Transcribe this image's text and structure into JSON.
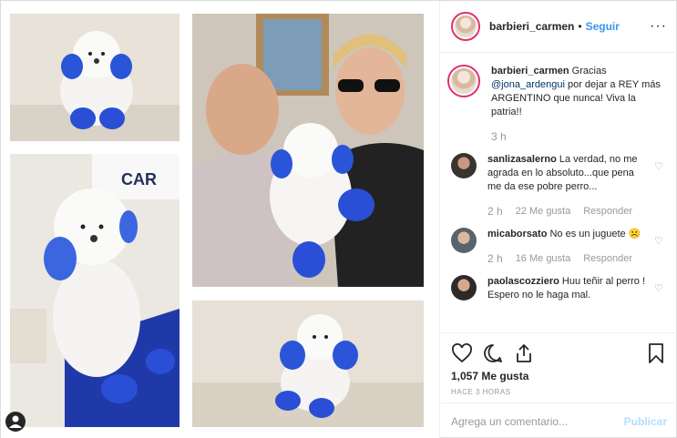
{
  "header": {
    "username": "barbieri_carmen",
    "separator": "•",
    "follow_label": "Seguir",
    "more_label": "···"
  },
  "caption": {
    "username": "barbieri_carmen",
    "text_before": " Gracias ",
    "mention": "@jona_ardengui",
    "text_after": " por dejar a REY más ARGENTINO que nunca! Viva la patria!!",
    "time": "3 h"
  },
  "comments": [
    {
      "username": "sanlizasalerno",
      "text": " La verdad, no me agrada en lo absoluto...que pena me da ese pobre perro...",
      "time": "2 h",
      "likes": "22 Me gusta",
      "reply": "Responder"
    },
    {
      "username": "micaborsato",
      "text": " No es un juguete ☹️",
      "time": "2 h",
      "likes": "16 Me gusta",
      "reply": "Responder"
    },
    {
      "username": "paolascozziero",
      "text": " Huu teñir al perro ! Espero no le haga mal.",
      "time": "",
      "likes": "",
      "reply": ""
    }
  ],
  "actions": {
    "likes": "1,057 Me gusta",
    "ago": "HACE 3 HORAS"
  },
  "add_comment": {
    "placeholder": "Agrega un comentario...",
    "publish_label": "Publicar"
  },
  "media": {
    "tag_icon": "person-icon",
    "image_text": "CAR"
  },
  "colors": {
    "accent": "#3897f0",
    "dye_blue": "#2a4fd6",
    "story_ring": "#e1306c"
  }
}
